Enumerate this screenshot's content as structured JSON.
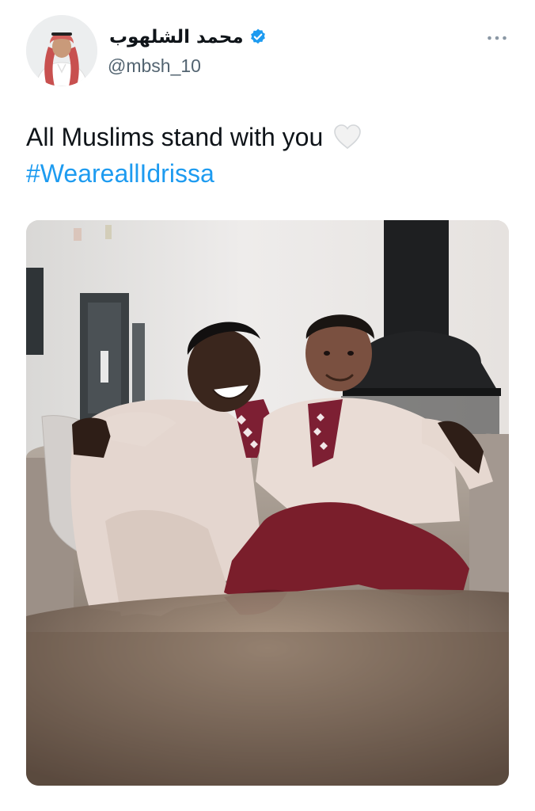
{
  "author": {
    "display_name": "محمد الشلهوب",
    "handle": "@mbsh_10",
    "verified": true,
    "verified_badge_icon": "verified-badge-icon",
    "avatar_icon": "avatar"
  },
  "header": {
    "more_icon": "more-options-icon"
  },
  "tweet": {
    "text": "All Muslims stand with you",
    "emoji_icon": "white-heart-icon",
    "hashtag": "#WeareallIdrissa"
  },
  "media": {
    "type": "photo",
    "description_icon": "tweet-photo"
  },
  "colors": {
    "accent": "#1d9bf0",
    "text": "#0f1419",
    "secondary_text": "#536471"
  }
}
